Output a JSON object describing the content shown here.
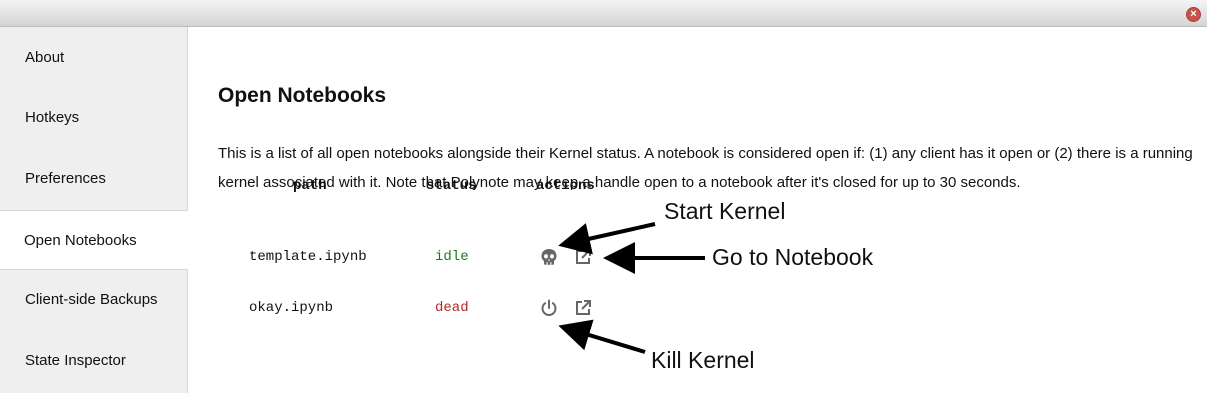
{
  "window": {
    "close_icon": "close-x-icon",
    "close_color": "#c9534b"
  },
  "sidebar": {
    "items": [
      {
        "label": "About",
        "active": false
      },
      {
        "label": "Hotkeys",
        "active": false
      },
      {
        "label": "Preferences",
        "active": false
      },
      {
        "label": "Open Notebooks",
        "active": true
      },
      {
        "label": "Client-side Backups",
        "active": false
      },
      {
        "label": "State Inspector",
        "active": false
      }
    ]
  },
  "main": {
    "title": "Open Notebooks",
    "description": "This is a list of all open notebooks alongside their Kernel status. A notebook is considered open if: (1) any client has it open or (2) there is a running kernel associated with it. Note that Polynote may keep a handle open to a notebook after it's closed for up to 30 seconds.",
    "table": {
      "headers": {
        "path": "path",
        "status": "status",
        "actions": "actions"
      },
      "rows": [
        {
          "path": "template.ipynb",
          "status": "idle",
          "status_color": "#1f7a1f",
          "kernel_icon": "skull-icon",
          "open_icon": "external-link-icon"
        },
        {
          "path": "okay.ipynb",
          "status": "dead",
          "status_color": "#b02a20",
          "kernel_icon": "power-icon",
          "open_icon": "external-link-icon"
        }
      ]
    }
  },
  "annotations": {
    "start_kernel": "Start Kernel",
    "go_to_notebook": "Go to Notebook",
    "kill_kernel": "Kill Kernel"
  }
}
